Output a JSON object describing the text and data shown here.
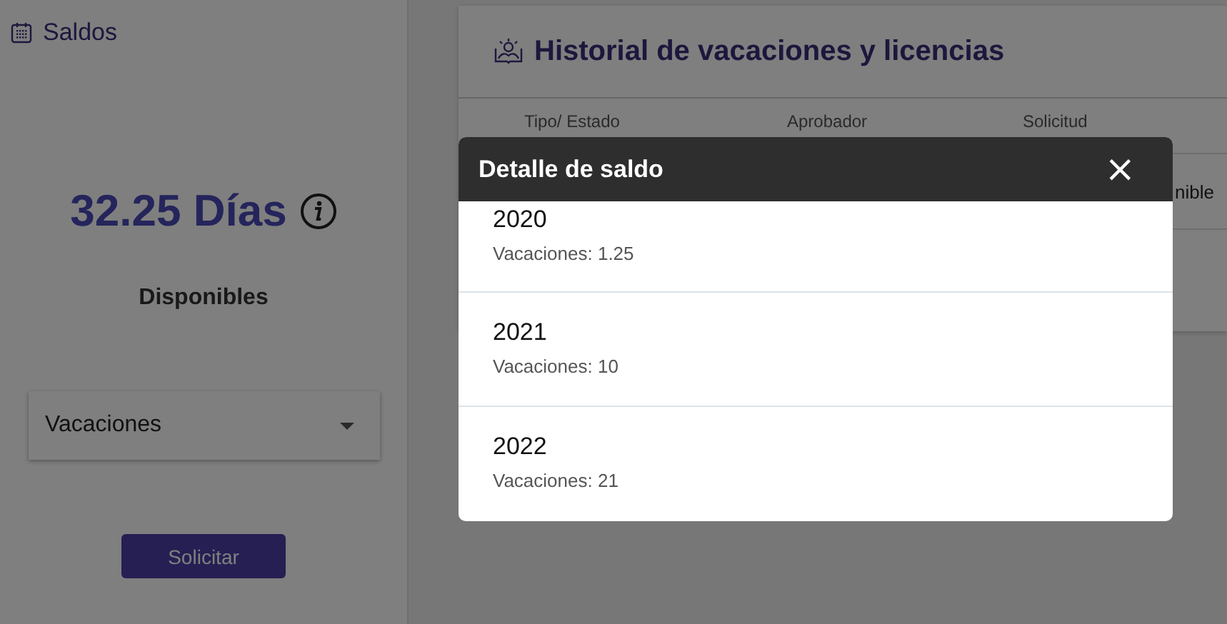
{
  "balance": {
    "title": "Saldos",
    "amount": "32.25 Días",
    "caption": "Disponibles",
    "type_select": {
      "value": "Vacaciones"
    },
    "request_button": "Solicitar"
  },
  "history": {
    "title": "Historial de vacaciones y licencias",
    "columns": [
      "Tipo/ Estado",
      "Aprobador",
      "Solicitud"
    ],
    "rows": [
      {
        "column_4": "nible"
      }
    ]
  },
  "dialog": {
    "title": "Detalle de saldo",
    "close": "×",
    "items": [
      {
        "year": "2020",
        "detail": "Vacaciones: 1.25"
      },
      {
        "year": "2021",
        "detail": "Vacaciones: 10"
      },
      {
        "year": "2022",
        "detail": "Vacaciones: 21"
      }
    ]
  }
}
